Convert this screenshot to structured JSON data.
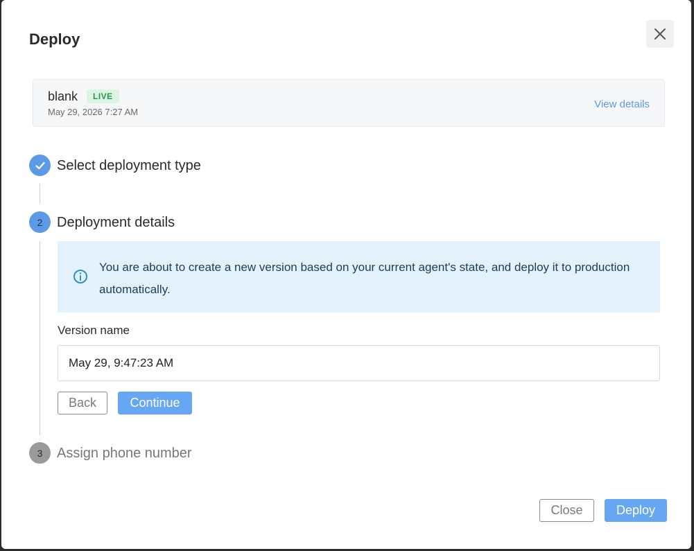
{
  "dialog": {
    "title": "Deploy",
    "close_icon": "close-icon"
  },
  "agent": {
    "name": "blank",
    "status_badge": "LIVE",
    "timestamp": "May 29, 2026 7:27 AM",
    "view_details_label": "View details"
  },
  "steps": [
    {
      "number": "1",
      "label": "Select deployment type",
      "state": "completed",
      "icon": "check-icon"
    },
    {
      "number": "2",
      "label": "Deployment details",
      "state": "active"
    },
    {
      "number": "3",
      "label": "Assign phone number",
      "state": "pending"
    }
  ],
  "details": {
    "info_icon": "info-icon",
    "info_message": "You are about to create a new version based on your current agent's state, and deploy it to production automatically.",
    "version_label": "Version name",
    "version_value": "May 29, 9:47:23 AM",
    "back_label": "Back",
    "continue_label": "Continue"
  },
  "footer": {
    "close_label": "Close",
    "deploy_label": "Deploy"
  },
  "colors": {
    "accent": "#5b9be6",
    "primary_button": "#66a6f2",
    "info_background": "#e3f2fc",
    "live_badge_bg": "#dcf5e3",
    "live_badge_text": "#1e9b4b",
    "pending_step": "#9a9a9a"
  }
}
